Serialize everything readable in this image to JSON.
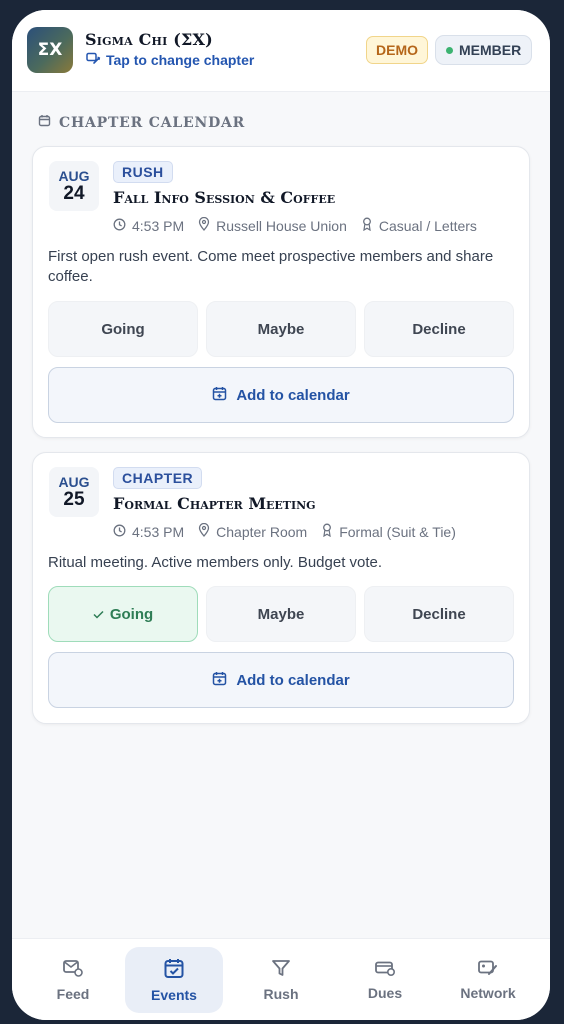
{
  "header": {
    "logo_text": "ΣX",
    "org_name": "Sigma Chi (ΣX)",
    "change_chapter": "Tap to change chapter",
    "demo_badge": "DEMO",
    "member_badge": "MEMBER"
  },
  "section": {
    "title": "CHAPTER CALENDAR"
  },
  "events": [
    {
      "month": "AUG",
      "day": "24",
      "tag": "RUSH",
      "title": "Fall Info Session & Coffee",
      "time": "4:53 PM",
      "location": "Russell House Union",
      "dress": "Casual / Letters",
      "description": "First open rush event. Come meet prospective members and share coffee.",
      "rsvp": {
        "going": "Going",
        "maybe": "Maybe",
        "decline": "Decline",
        "selected": ""
      },
      "add_to_calendar": "Add to calendar"
    },
    {
      "month": "AUG",
      "day": "25",
      "tag": "CHAPTER",
      "title": "Formal Chapter Meeting",
      "time": "4:53 PM",
      "location": "Chapter Room",
      "dress": "Formal (Suit & Tie)",
      "description": "Ritual meeting. Active members only. Budget vote.",
      "rsvp": {
        "going": "Going",
        "maybe": "Maybe",
        "decline": "Decline",
        "selected": "going"
      },
      "add_to_calendar": "Add to calendar"
    }
  ],
  "nav": {
    "items": [
      {
        "label": "Feed",
        "icon": "feed-icon"
      },
      {
        "label": "Events",
        "icon": "calendar-check-icon",
        "active": true
      },
      {
        "label": "Rush",
        "icon": "funnel-icon"
      },
      {
        "label": "Dues",
        "icon": "wallet-icon"
      },
      {
        "label": "Network",
        "icon": "network-icon"
      }
    ]
  },
  "colors": {
    "accent": "#2453a4",
    "going_active_bg": "#eaf8f0",
    "going_active_text": "#2e7d55",
    "demo_text": "#b5661a",
    "online_dot": "#3cb371"
  }
}
